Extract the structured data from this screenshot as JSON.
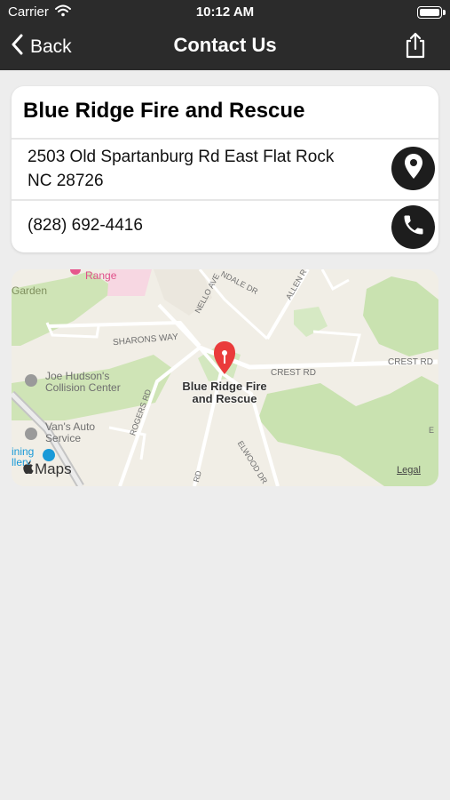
{
  "status_bar": {
    "carrier": "Carrier",
    "time": "10:12 AM"
  },
  "nav": {
    "back_label": "Back",
    "title": "Contact Us"
  },
  "contact": {
    "name": "Blue Ridge Fire and Rescue",
    "address_line1": "2503 Old Spartanburg Rd East Flat Rock",
    "address_line2": "NC 28726",
    "phone": "(828) 692-4416"
  },
  "map": {
    "pin_label_line1": "Blue Ridge Fire",
    "pin_label_line2": "and Rescue",
    "places": {
      "range": "Range",
      "garden": "Garden",
      "joe_hudsons_1": "Joe Hudson's",
      "joe_hudsons_2": "Collision Center",
      "vans_1": "Van's Auto",
      "vans_2": "Service",
      "dining_1": "ining",
      "dining_2": "llery"
    },
    "streets": {
      "nello_ave": "NELLO AVE",
      "sharons_way": "SHARONS WAY",
      "crest_rd": "CREST RD",
      "crest_rd_2": "CREST RD",
      "rogers_rd": "ROGERS RD",
      "elwood_dr": "ELWOOD DR",
      "allen_r": "ALLEN R",
      "ndale_dr": "NDALE DR",
      "rd": "RD",
      "e": "E"
    },
    "brand": "Maps",
    "legal": "Legal",
    "pin_color": "#ea3b3b"
  }
}
